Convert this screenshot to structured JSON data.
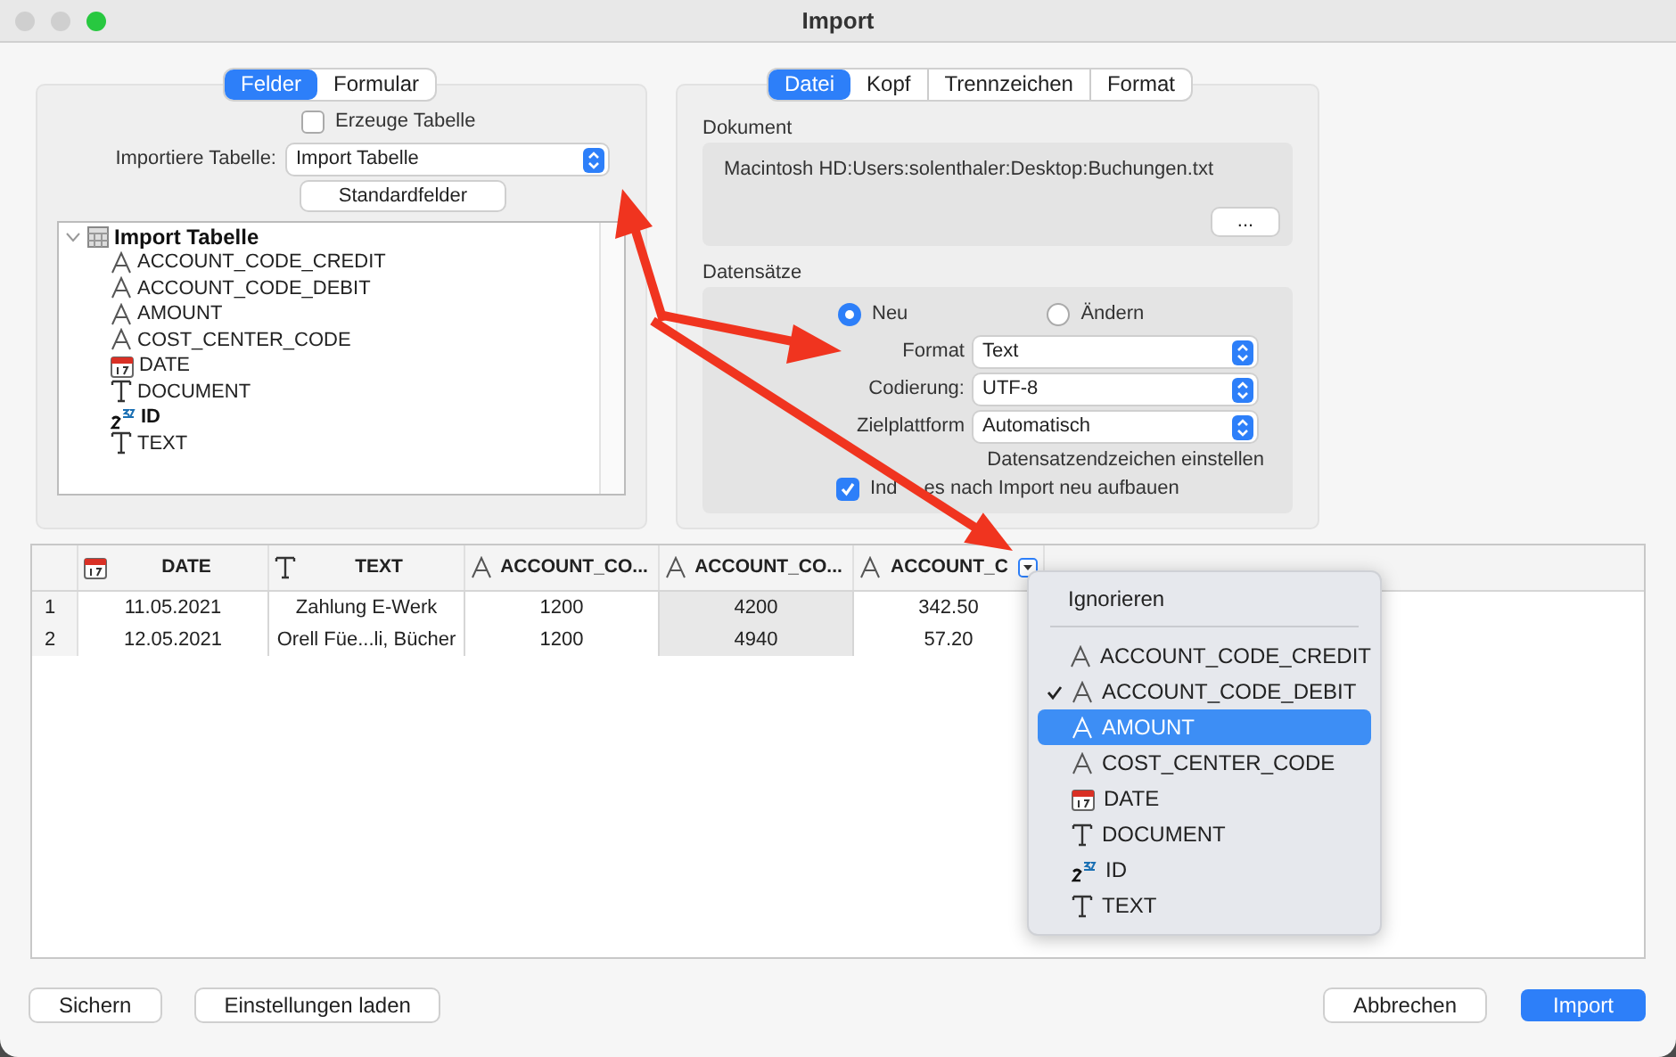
{
  "window": {
    "title": "Import"
  },
  "left_panel": {
    "tabs": [
      {
        "label": "Felder",
        "selected": true
      },
      {
        "label": "Formular",
        "selected": false
      }
    ],
    "create_table": {
      "label": "Erzeuge Tabelle",
      "checked": false
    },
    "import_table": {
      "label": "Importiere Tabelle:",
      "value": "Import Tabelle"
    },
    "standard_button": "Standardfelder",
    "tree": {
      "label": "Import Tabelle",
      "expanded": true,
      "children": [
        {
          "label": "ACCOUNT_CODE_CREDIT",
          "kind": "string"
        },
        {
          "label": "ACCOUNT_CODE_DEBIT",
          "kind": "string"
        },
        {
          "label": "AMOUNT",
          "kind": "string"
        },
        {
          "label": "COST_CENTER_CODE",
          "kind": "string"
        },
        {
          "label": "DATE",
          "kind": "date"
        },
        {
          "label": "DOCUMENT",
          "kind": "text"
        },
        {
          "label": "ID",
          "kind": "integer",
          "bold": true
        },
        {
          "label": "TEXT",
          "kind": "text"
        }
      ]
    }
  },
  "right_panel": {
    "tabs": [
      {
        "label": "Datei",
        "selected": true
      },
      {
        "label": "Kopf",
        "selected": false
      },
      {
        "label": "Trennzeichen",
        "selected": false
      },
      {
        "label": "Format",
        "selected": false
      }
    ],
    "document": {
      "title": "Dokument",
      "path": "Macintosh HD:Users:solenthaler:Desktop:Buchungen.txt",
      "browse_button": "..."
    },
    "records": {
      "title": "Datensätze",
      "radios": [
        {
          "label": "Neu",
          "selected": true
        },
        {
          "label": "Ändern",
          "selected": false
        }
      ],
      "selects": [
        {
          "label": "Format",
          "value": "Text"
        },
        {
          "label": "Codierung:",
          "value": "UTF-8"
        },
        {
          "label": "Zielplattform",
          "value": "Automatisch"
        }
      ],
      "link": "Datensatzendzeichen einstellen",
      "rebuild_indexes": {
        "label_parts": [
          "Ind",
          "es nach Import neu aufbauen"
        ],
        "checked": true
      }
    }
  },
  "table": {
    "columns": [
      {
        "label": "DATE",
        "kind": "date",
        "selected": false,
        "menu_button": false
      },
      {
        "label": "TEXT",
        "kind": "text",
        "selected": false,
        "menu_button": false
      },
      {
        "label": "ACCOUNT_CO...",
        "kind": "string",
        "selected": false,
        "menu_button": false
      },
      {
        "label": "ACCOUNT_CO...",
        "kind": "string",
        "selected": true,
        "menu_button": false
      },
      {
        "label": "ACCOUNT_C",
        "kind": "string",
        "selected": false,
        "menu_button": true
      }
    ],
    "rows": [
      {
        "number": "1",
        "cells": [
          "11.05.2021",
          "Zahlung E-Werk",
          "1200",
          "4200",
          "342.50"
        ]
      },
      {
        "number": "2",
        "cells": [
          "12.05.2021",
          "Orell Füe...li, Bücher",
          "1200",
          "4940",
          "57.20"
        ]
      }
    ]
  },
  "field_menu": {
    "header": "Ignorieren",
    "items": [
      {
        "label": "ACCOUNT_CODE_CREDIT",
        "kind": "string",
        "checked": false,
        "selected": false
      },
      {
        "label": "ACCOUNT_CODE_DEBIT",
        "kind": "string",
        "checked": true,
        "selected": false
      },
      {
        "label": "AMOUNT",
        "kind": "string",
        "checked": false,
        "selected": true
      },
      {
        "label": "COST_CENTER_CODE",
        "kind": "string",
        "checked": false,
        "selected": false
      },
      {
        "label": "DATE",
        "kind": "date",
        "checked": false,
        "selected": false
      },
      {
        "label": "DOCUMENT",
        "kind": "text",
        "checked": false,
        "selected": false
      },
      {
        "label": "ID",
        "kind": "integer",
        "checked": false,
        "selected": false
      },
      {
        "label": "TEXT",
        "kind": "text",
        "checked": false,
        "selected": false
      }
    ]
  },
  "buttons_left": [
    {
      "label": "Sichern",
      "default": false
    },
    {
      "label": "Einstellungen laden",
      "default": false
    }
  ],
  "buttons_right": [
    {
      "label": "Abbrechen",
      "default": false
    },
    {
      "label": "Import",
      "default": true
    }
  ]
}
